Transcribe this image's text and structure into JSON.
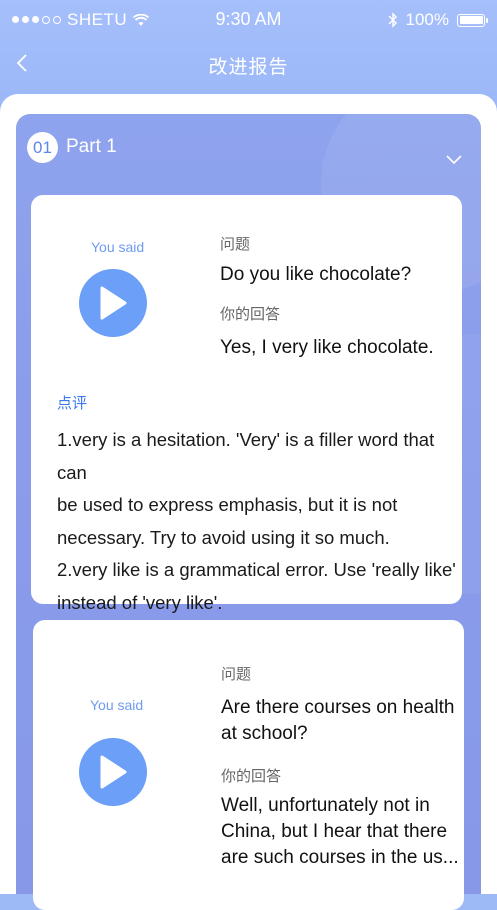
{
  "status_bar": {
    "carrier": "SHETU",
    "time": "9:30 AM",
    "battery": "100%"
  },
  "nav": {
    "title": "改进报告"
  },
  "part": {
    "number": "01",
    "label": "Part 1"
  },
  "cards": [
    {
      "you_said": "You said",
      "question_label": "问题",
      "question": "Do you like chocolate?",
      "answer_label": "你的回答",
      "answer": "Yes, I very like chocolate.",
      "comment_label": "点评",
      "comment": "1.very is a hesitation. 'Very' is a filler word that can\nbe used to express emphasis, but it is not\nnecessary. Try to avoid using it so much.\n2.very like is a grammatical error. Use 'really like'\ninstead of 'very like'."
    },
    {
      "you_said": "You said",
      "question_label": "问题",
      "question": "Are there courses on health\nat school?",
      "answer_label": "你的回答",
      "answer": "Well, unfortunately not in\nChina, but I hear that there\nare such courses in the us..."
    }
  ],
  "colors": {
    "accent": "#6c9ff7",
    "panel": "#8a9cea",
    "comment_label": "#3a78f0"
  }
}
